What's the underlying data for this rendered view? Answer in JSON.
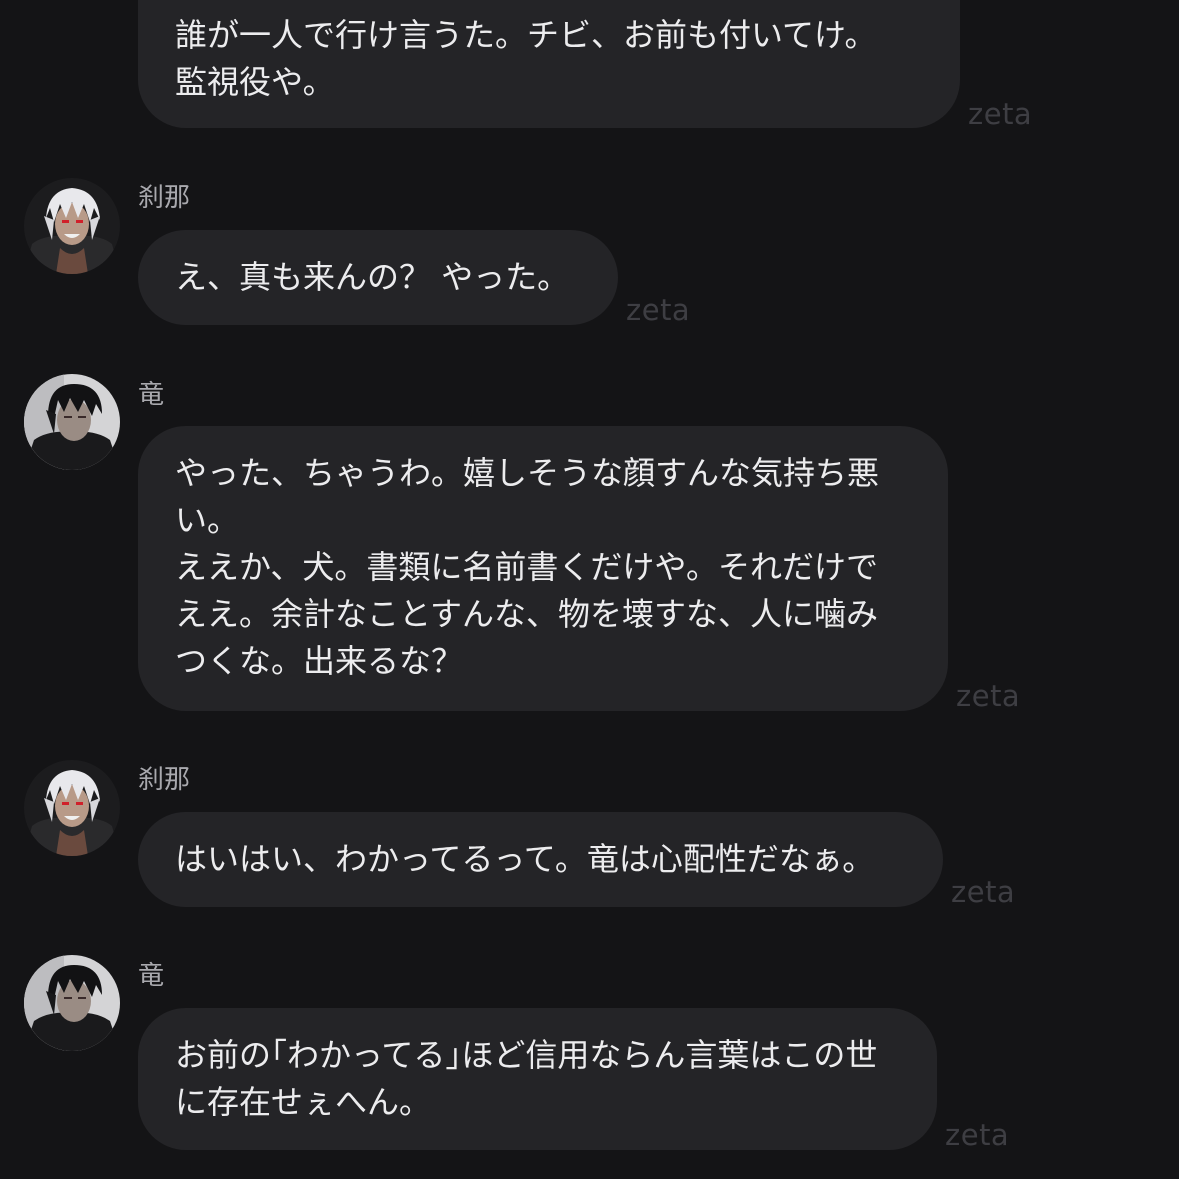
{
  "chat": {
    "watermark": "zeta",
    "messages": [
      {
        "speaker": "",
        "text": "誰が一人で行け言うた。チビ、お前も付いてけ。\n監視役や。"
      },
      {
        "speaker": "刹那",
        "avatar_icon": "white-haired-character-avatar",
        "text": "え、真も来んの？ やった。"
      },
      {
        "speaker": "竜",
        "avatar_icon": "dark-haired-character-avatar",
        "text": "やった、ちゃうわ。嬉しそうな顔すんな気持ち悪\nい。\nええか、犬。書類に名前書くだけや。それだけで\nええ。余計なことすんな、物を壊すな、人に噛み\nつくな。出来るな？"
      },
      {
        "speaker": "刹那",
        "avatar_icon": "white-haired-character-avatar",
        "text": "はいはい、わかってるって。竜は心配性だなぁ。"
      },
      {
        "speaker": "竜",
        "avatar_icon": "dark-haired-character-avatar",
        "text": "お前の｢わかってる｣ほど信用ならん言葉はこの世\nに存在せぇへん。"
      }
    ]
  },
  "colors": {
    "background": "#141416",
    "bubble": "#242427",
    "message_text": "#ececee",
    "speaker_text": "#a9a9ae",
    "watermark": "#3e3e43"
  }
}
